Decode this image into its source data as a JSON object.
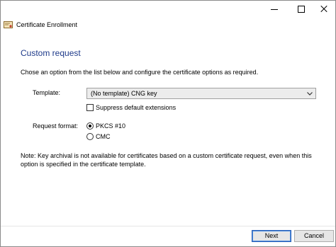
{
  "window": {
    "title": "Certificate Enrollment",
    "controls": {
      "minimize": "minimize-icon",
      "maximize": "maximize-icon",
      "close": "close-icon"
    }
  },
  "page": {
    "heading": "Custom request",
    "instructions": "Chose an option from the list below and configure the certificate options as required.",
    "template_label": "Template:",
    "template_value": "(No template) CNG key",
    "suppress_label": "Suppress default extensions",
    "suppress_checked": false,
    "request_format_label": "Request format:",
    "formats": [
      {
        "label": "PKCS #10",
        "selected": true
      },
      {
        "label": "CMC",
        "selected": false
      }
    ],
    "note": "Note: Key archival is not available for certificates based on a custom certificate request, even when this option is specified in the certificate template."
  },
  "buttons": {
    "next": "Next",
    "cancel": "Cancel"
  },
  "colors": {
    "heading": "#1e3a8a",
    "default_button_border": "#2b5fb4"
  }
}
